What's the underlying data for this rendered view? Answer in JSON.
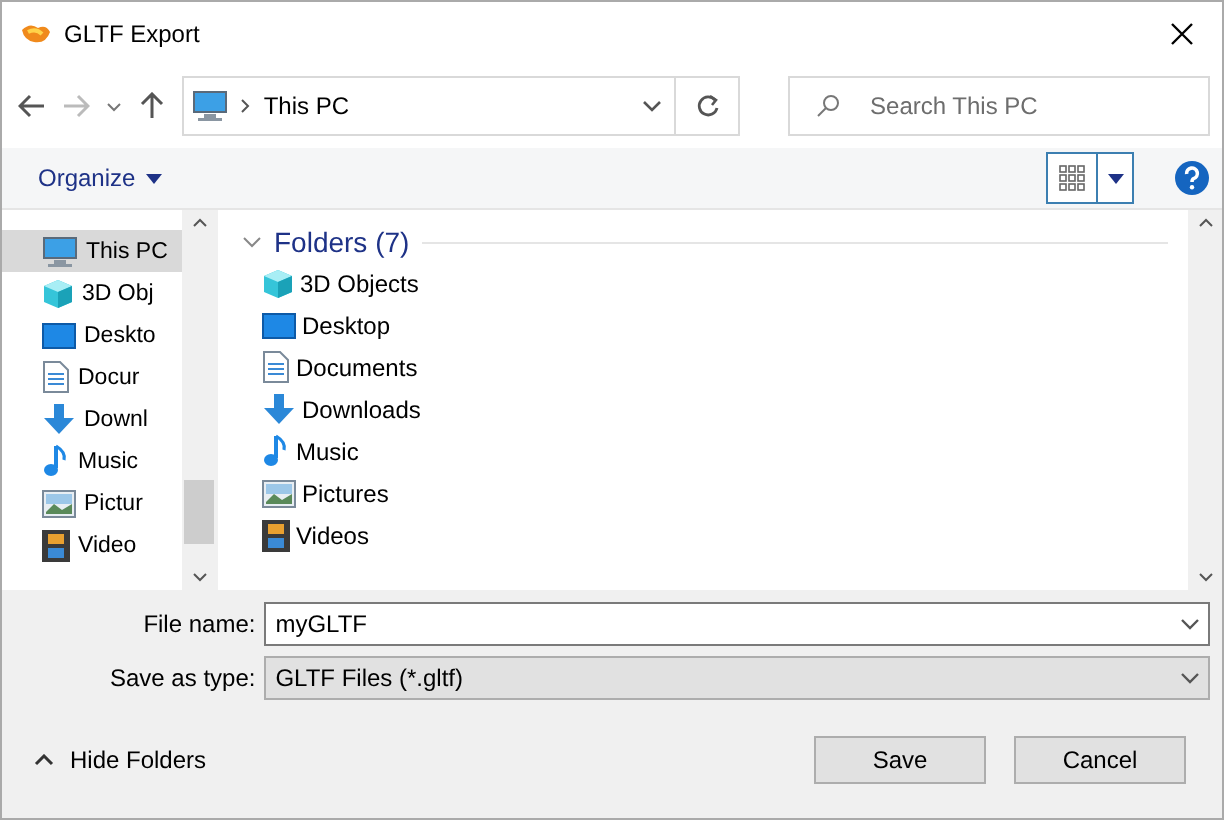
{
  "window": {
    "title": "GLTF Export"
  },
  "address": {
    "path": "This PC",
    "search_placeholder": "Search This PC"
  },
  "toolbar": {
    "organize": "Organize"
  },
  "sidebar": {
    "items": [
      {
        "label": "This PC",
        "kind": "pc",
        "selected": true
      },
      {
        "label": "3D Obj",
        "kind": "objects3d",
        "selected": false
      },
      {
        "label": "Deskto",
        "kind": "desktop",
        "selected": false
      },
      {
        "label": "Docur",
        "kind": "documents",
        "selected": false
      },
      {
        "label": "Downl",
        "kind": "downloads",
        "selected": false
      },
      {
        "label": "Music",
        "kind": "music",
        "selected": false
      },
      {
        "label": "Pictur",
        "kind": "pictures",
        "selected": false
      },
      {
        "label": "Video",
        "kind": "videos",
        "selected": false
      }
    ]
  },
  "folders": {
    "heading": "Folders (7)",
    "items": [
      {
        "label": "3D Objects",
        "kind": "objects3d"
      },
      {
        "label": "Desktop",
        "kind": "desktop"
      },
      {
        "label": "Documents",
        "kind": "documents"
      },
      {
        "label": "Downloads",
        "kind": "downloads"
      },
      {
        "label": "Music",
        "kind": "music"
      },
      {
        "label": "Pictures",
        "kind": "pictures"
      },
      {
        "label": "Videos",
        "kind": "videos"
      }
    ]
  },
  "form": {
    "file_name_label": "File name:",
    "file_name": "myGLTF",
    "type_label": "Save as type:",
    "type": "GLTF Files (*.gltf)"
  },
  "footer": {
    "hide_folders": "Hide Folders",
    "buttons": [
      "Save",
      "Cancel"
    ]
  }
}
